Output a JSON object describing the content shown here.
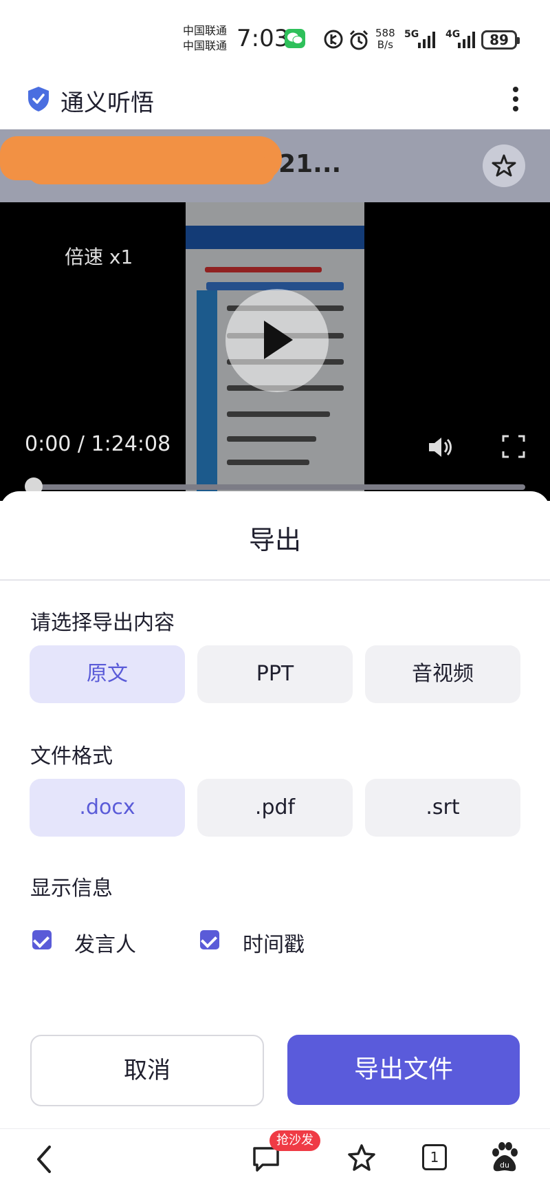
{
  "status_bar": {
    "carrier_1": "中国联通",
    "carrier_2": "中国联通",
    "time": "7:03",
    "net_speed_value": "588",
    "net_speed_unit": "B/s",
    "signal_1_label": "5G",
    "signal_2_label": "4G",
    "battery": "89"
  },
  "app": {
    "title": "通义听悟"
  },
  "video": {
    "title_visible": "521...",
    "speed_label": "倍速 x1",
    "time_display": "0:00 / 1:24:08",
    "progress": 0
  },
  "export_sheet": {
    "title": "导出",
    "content_label": "请选择导出内容",
    "content_options": [
      "原文",
      "PPT",
      "音视频"
    ],
    "content_selected": "原文",
    "format_label": "文件格式",
    "format_options": [
      ".docx",
      ".pdf",
      ".srt"
    ],
    "format_selected": ".docx",
    "display_label": "显示信息",
    "display_options": [
      {
        "label": "发言人",
        "checked": true
      },
      {
        "label": "时间戳",
        "checked": true
      }
    ],
    "cancel_label": "取消",
    "export_label": "导出文件"
  },
  "browser_bar": {
    "comment_badge": "抢沙发",
    "tab_count": "1"
  },
  "colors": {
    "accent": "#5a5bdb",
    "selected_bg": "#e5e5fb",
    "badge": "#ef3b45",
    "redaction": "#f29144"
  }
}
